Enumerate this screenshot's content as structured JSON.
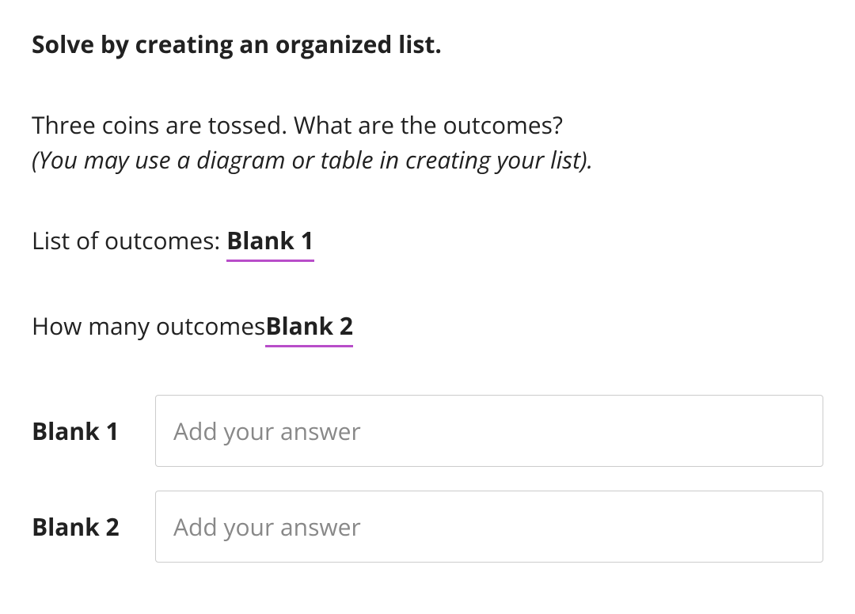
{
  "question": {
    "title": "Solve by creating an organized list.",
    "problem_line1": "Three coins are tossed. What are the outcomes?",
    "problem_hint": "(You may use a diagram or table in creating your list).",
    "prompt1_prefix": "List of outcomes: ",
    "prompt1_blank": "Blank 1",
    "prompt2_prefix": "How many outcomes",
    "prompt2_blank": "Blank 2"
  },
  "answers": [
    {
      "label": "Blank 1",
      "placeholder": "Add your answer",
      "value": ""
    },
    {
      "label": "Blank 2",
      "placeholder": "Add your answer",
      "value": ""
    }
  ]
}
